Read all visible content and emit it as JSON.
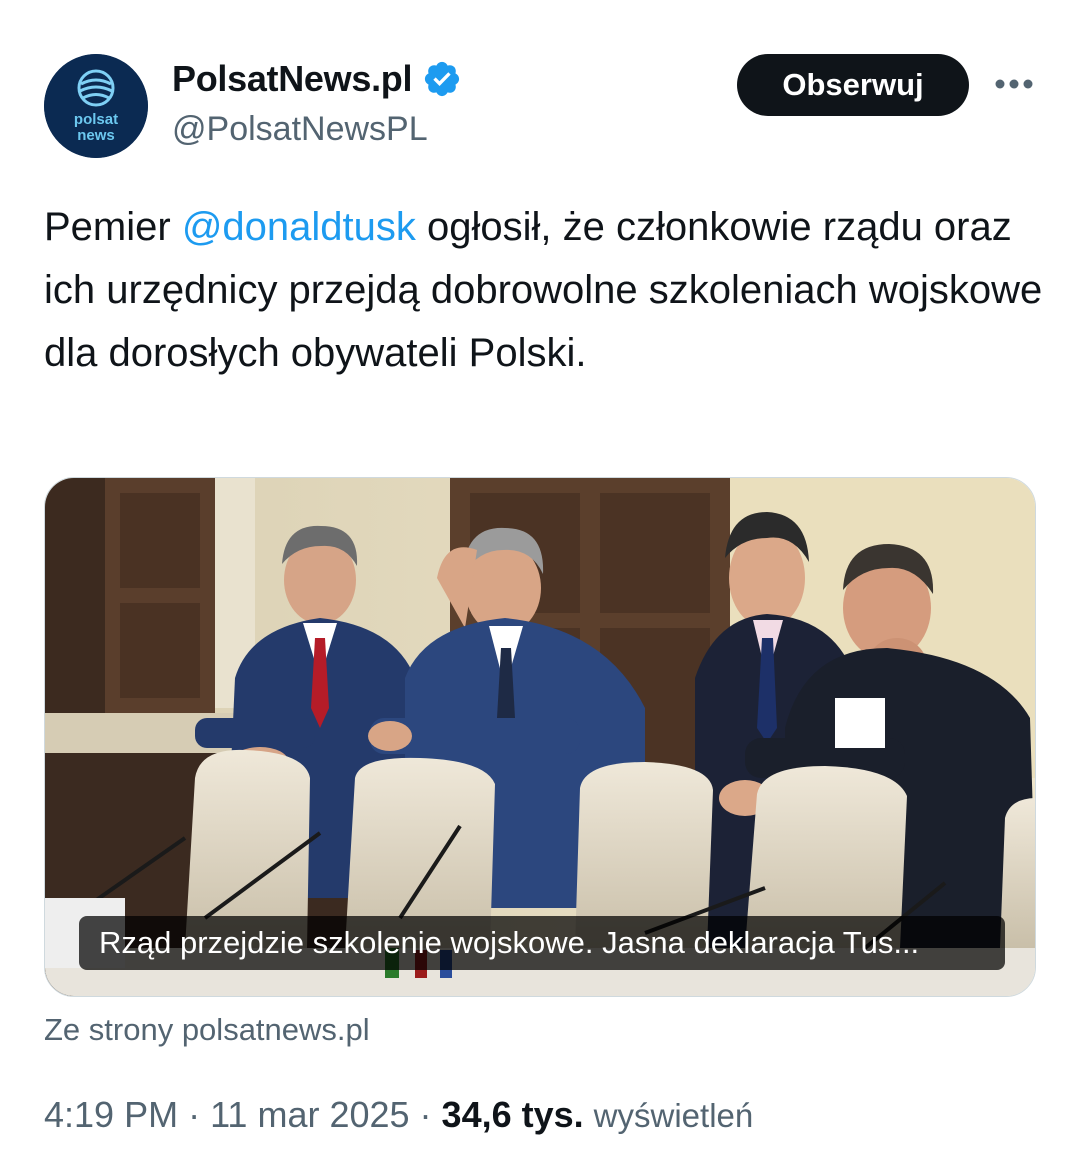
{
  "account": {
    "display_name": "PolsatNews.pl",
    "handle": "@PolsatNewsPL",
    "verified": true,
    "avatar_text_line1": "polsat",
    "avatar_text_line2": "news"
  },
  "header": {
    "follow_label": "Obserwuj",
    "more_icon": "more-horizontal-icon"
  },
  "tweet": {
    "text_before": "Pemier ",
    "mention": "@donaldtusk",
    "text_after": " ogłosił, że członkowie rządu oraz ich urzędnicy przejdą dobrowolne szkoleniach wojskowe dla dorosłych obywateli Polski."
  },
  "card": {
    "caption": "Rząd przejdzie szkolenie wojskowe. Jasna deklaracja Tus...",
    "source": "Ze strony polsatnews.pl"
  },
  "meta": {
    "time": "4:19 PM",
    "separator": " · ",
    "date": "11 mar 2025",
    "views_count": "34,6 tys.",
    "views_label": "wyświetleń"
  },
  "colors": {
    "text": "#0f1419",
    "secondary": "#536471",
    "link": "#1d9bf0",
    "verified": "#1d9bf0",
    "button_bg": "#0f1419",
    "avatar_bg": "#0b2a52"
  }
}
